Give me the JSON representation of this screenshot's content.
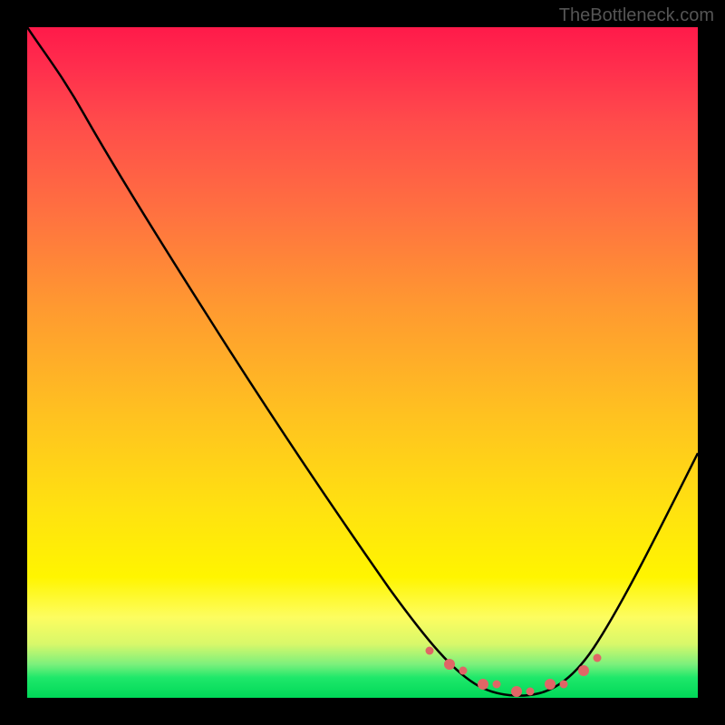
{
  "watermark": "TheBottleneck.com",
  "colors": {
    "page_bg": "#000000",
    "watermark": "#555555",
    "curve": "#000000",
    "bead": "#e06666",
    "gradient_top": "#ff1a4a",
    "gradient_bottom": "#00d858"
  },
  "chart_data": {
    "type": "line",
    "title": "",
    "xlabel": "",
    "ylabel": "",
    "xlim": [
      0,
      100
    ],
    "ylim": [
      0,
      100
    ],
    "grid": false,
    "legend": false,
    "notes": "No axis ticks or numeric labels are rendered in the image; x/y units are normalized 0-100. Higher y = higher bottleneck (red). Curve reaches minimum (green zone) roughly between x=63 and x=82.",
    "series": [
      {
        "name": "bottleneck-curve",
        "x": [
          0,
          4,
          8,
          12,
          20,
          30,
          40,
          50,
          58,
          63,
          68,
          72,
          76,
          80,
          84,
          88,
          92,
          96,
          100
        ],
        "y": [
          100,
          96,
          90,
          84,
          71,
          56,
          41,
          26,
          14,
          6,
          2,
          1,
          1,
          2,
          6,
          14,
          25,
          37,
          49
        ]
      }
    ],
    "highlight_points": {
      "name": "optimal-range-beads",
      "x": [
        60,
        63,
        65,
        68,
        70,
        73,
        75,
        78,
        80,
        83,
        85
      ],
      "y": [
        7,
        5,
        4,
        2,
        2,
        1,
        1,
        2,
        2,
        4,
        6
      ]
    },
    "background_gradient_stops": [
      {
        "pct": 0,
        "color": "#ff1a4a"
      },
      {
        "pct": 6,
        "color": "#ff2e4d"
      },
      {
        "pct": 14,
        "color": "#ff4b4b"
      },
      {
        "pct": 28,
        "color": "#ff7240"
      },
      {
        "pct": 42,
        "color": "#ff9a30"
      },
      {
        "pct": 58,
        "color": "#ffc220"
      },
      {
        "pct": 72,
        "color": "#ffe210"
      },
      {
        "pct": 82,
        "color": "#fff500"
      },
      {
        "pct": 88,
        "color": "#fdfd60"
      },
      {
        "pct": 92,
        "color": "#d8f86a"
      },
      {
        "pct": 95,
        "color": "#7cf07c"
      },
      {
        "pct": 97,
        "color": "#1ee86a"
      },
      {
        "pct": 100,
        "color": "#00d858"
      }
    ]
  }
}
